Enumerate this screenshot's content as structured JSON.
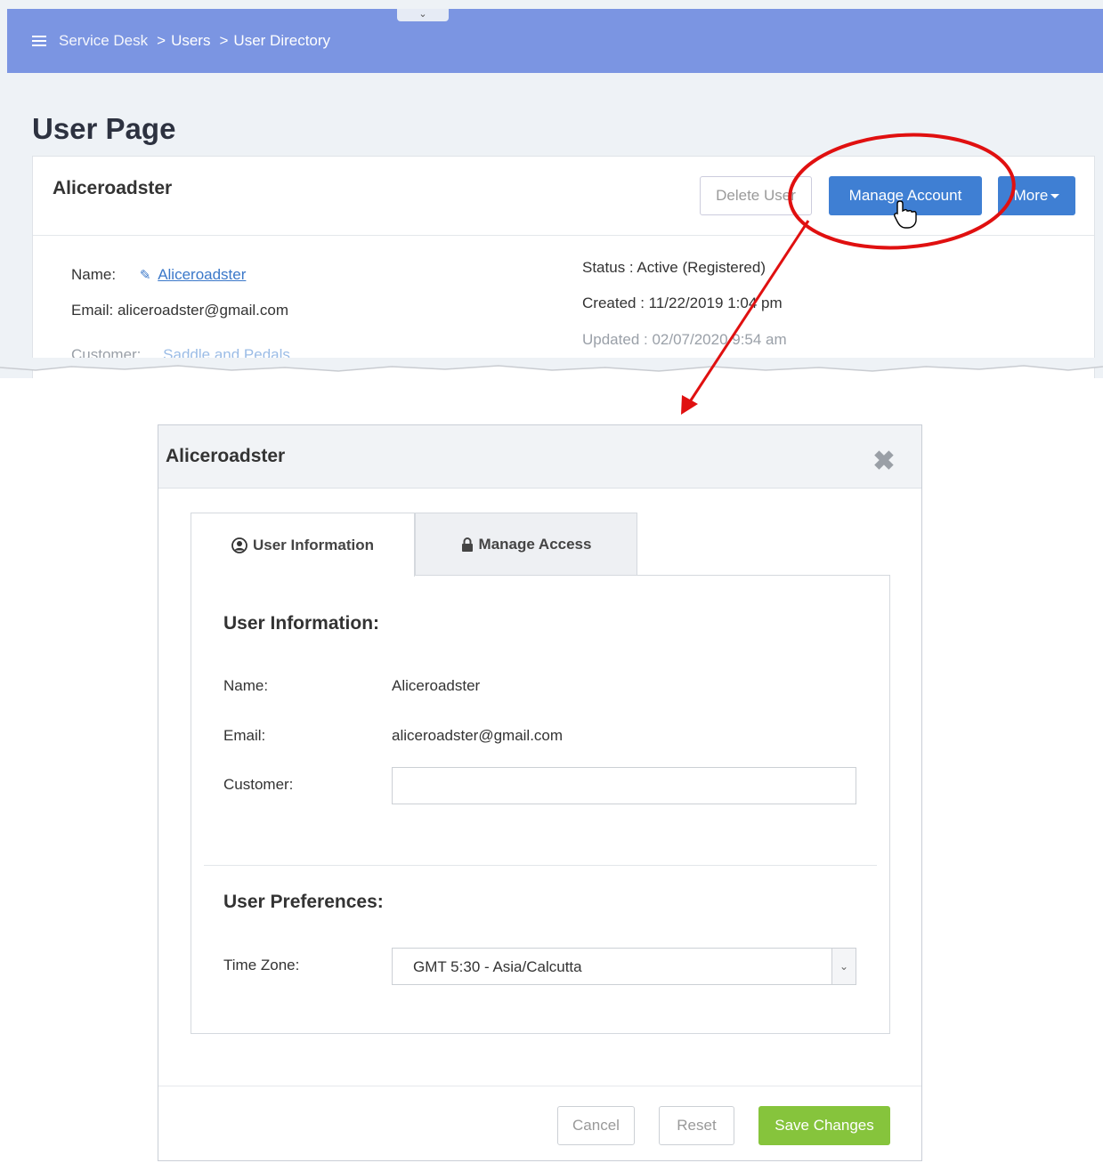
{
  "topbar": {
    "breadcrumbs": [
      "Service Desk",
      "Users",
      "User Directory"
    ],
    "separator": ">"
  },
  "page": {
    "title": "User Page"
  },
  "user_card": {
    "username": "Aliceroadster",
    "buttons": {
      "delete": "Delete User",
      "manage": "Manage Account",
      "more": "More"
    },
    "name_label": "Name:",
    "name_value": "Aliceroadster",
    "email_line": "Email: aliceroadster@gmail.com",
    "customer_label": "Customer:",
    "customer_value": "Saddle and Pedals",
    "status": "Status : Active (Registered)",
    "created": "Created : 11/22/2019 1:04 pm",
    "updated": "Updated : 02/07/2020 9:54 am"
  },
  "dialog": {
    "title": "Aliceroadster",
    "close_icon": "close-icon",
    "tabs": [
      {
        "label": "User Information",
        "icon": "user-circle-icon",
        "active": true
      },
      {
        "label": "Manage Access",
        "icon": "lock-icon",
        "active": false
      }
    ],
    "user_info": {
      "heading": "User Information:",
      "name_label": "Name:",
      "name_value": "Aliceroadster",
      "email_label": "Email:",
      "email_value": "aliceroadster@gmail.com",
      "customer_label": "Customer:",
      "customer_value": ""
    },
    "preferences": {
      "heading": "User Preferences:",
      "timezone_label": "Time Zone:",
      "timezone_value": "GMT 5:30 - Asia/Calcutta"
    },
    "footer": {
      "cancel": "Cancel",
      "reset": "Reset",
      "save": "Save Changes"
    }
  },
  "colors": {
    "topbar": "#7b95e2",
    "primary_button": "#3f7fd3",
    "save_button": "#86c43c",
    "annotation": "#e01010",
    "link": "#3b78c9"
  }
}
